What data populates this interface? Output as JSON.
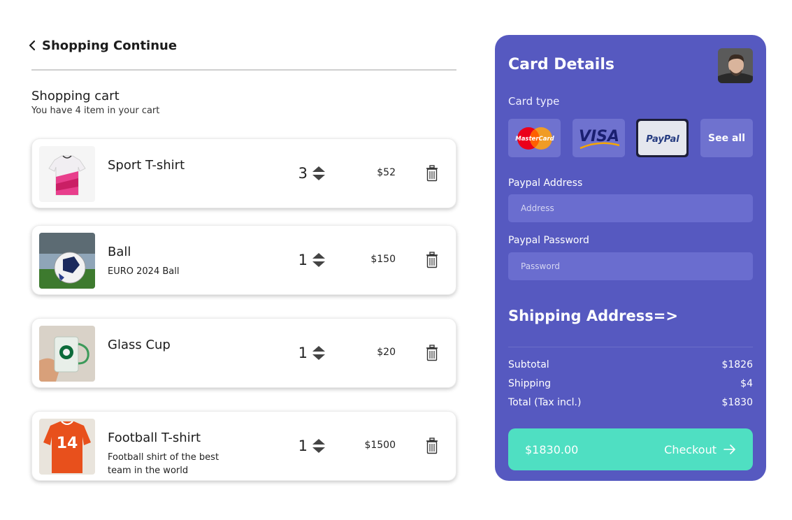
{
  "nav": {
    "back_label": "Shopping Continue"
  },
  "cart": {
    "title": "Shopping cart",
    "subtitle": "You have 4 item in your cart",
    "items": [
      {
        "name": "Sport T-shirt",
        "desc": "",
        "qty": "3",
        "price": "$52",
        "image": "pink-sport-tshirt"
      },
      {
        "name": "Ball",
        "desc": "EURO 2024 Ball",
        "qty": "1",
        "price": "$150",
        "image": "football-ball"
      },
      {
        "name": "Glass Cup",
        "desc": "",
        "qty": "1",
        "price": "$20",
        "image": "glass-mug"
      },
      {
        "name": "Football T-shirt",
        "desc": "Football shirt of the best team in the world",
        "qty": "1",
        "price": "$1500",
        "image": "orange-football-shirt"
      }
    ]
  },
  "card": {
    "title": "Card Details",
    "type_label": "Card type",
    "options": [
      {
        "name": "MasterCard",
        "selected": false
      },
      {
        "name": "VISA",
        "selected": false
      },
      {
        "name": "PayPal",
        "selected": true
      },
      {
        "name": "See all",
        "selected": false
      }
    ],
    "address_label": "Paypal Address",
    "address_placeholder": "Address",
    "password_label": "Paypal Password",
    "password_placeholder": "Password",
    "shipping_link": "Shipping Address=>"
  },
  "summary": {
    "subtotal_label": "Subtotal",
    "subtotal": "$1826",
    "shipping_label": "Shipping",
    "shipping": "$4",
    "total_label": "Total (Tax incl.)",
    "total": "$1830"
  },
  "checkout": {
    "amount": "$1830.00",
    "label": "Checkout"
  },
  "colors": {
    "panel": "#5659c0",
    "checkout": "#4fdfc2",
    "input": "#6a6dcf"
  }
}
